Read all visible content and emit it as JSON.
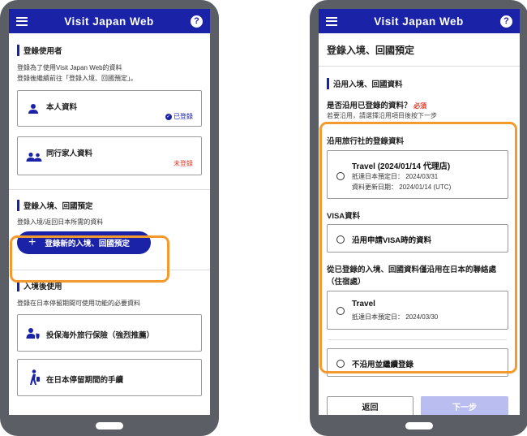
{
  "app": {
    "title": "Visit Japan Web",
    "help": "?"
  },
  "left": {
    "section1": {
      "title": "登錄使用者",
      "desc_line1": "登錄為了使用Visit Japan Web的資料",
      "desc_line2": "登錄後繼續前往「登錄入境、回國預定」。",
      "card_self": {
        "label": "本人資料",
        "status": "已登錄"
      },
      "card_family": {
        "label": "同行家人資料",
        "status": "未登錄"
      }
    },
    "section2": {
      "title": "登錄入境、回國預定",
      "desc": "登錄入境/返回日本所需的資料",
      "button": "登錄新的入境、回國預定",
      "button_icon": "+"
    },
    "section3": {
      "title": "入境後使用",
      "desc": "登錄在日本停留期間可使用功能的必要資料",
      "card_insurance": "投保海外旅行保險（強烈推薦）",
      "card_procedures": "在日本停留期間的手續"
    }
  },
  "right": {
    "header_title": "登錄入境、回國預定",
    "section_title": "沿用入境、回國資料",
    "question": "是否沿用已登錄的資料？",
    "required": "必須",
    "hint": "若要沿用，請選擇沿用項目後按下一步",
    "group1": {
      "title": "沿用旅行社的登錄資料",
      "option_title": "Travel (2024/01/14 代理店)",
      "option_arrival": "抵達日本預定日： 2024/03/31",
      "option_updated": "資料更新日期： 2024/01/14 (UTC)"
    },
    "group2": {
      "title": "VISA資料",
      "option": "沿用申請VISA時的資料"
    },
    "group3": {
      "title_line1": "從已登錄的入境、回國資料僅沿用在日本的聯絡處",
      "title_line2": "（住宿處）",
      "option_title": "Travel",
      "option_arrival": "抵達日本預定日： 2024/03/30"
    },
    "option_none": "不沿用並繼續登錄",
    "back_button": "返回",
    "next_button": "下一步"
  },
  "colors": {
    "brand": "#1a22a8",
    "highlight": "#f49a2d",
    "registered": "#1a22a8",
    "unregistered": "#e03a2a",
    "required": "#e03a2a",
    "disabled": "#b9bdf0"
  }
}
